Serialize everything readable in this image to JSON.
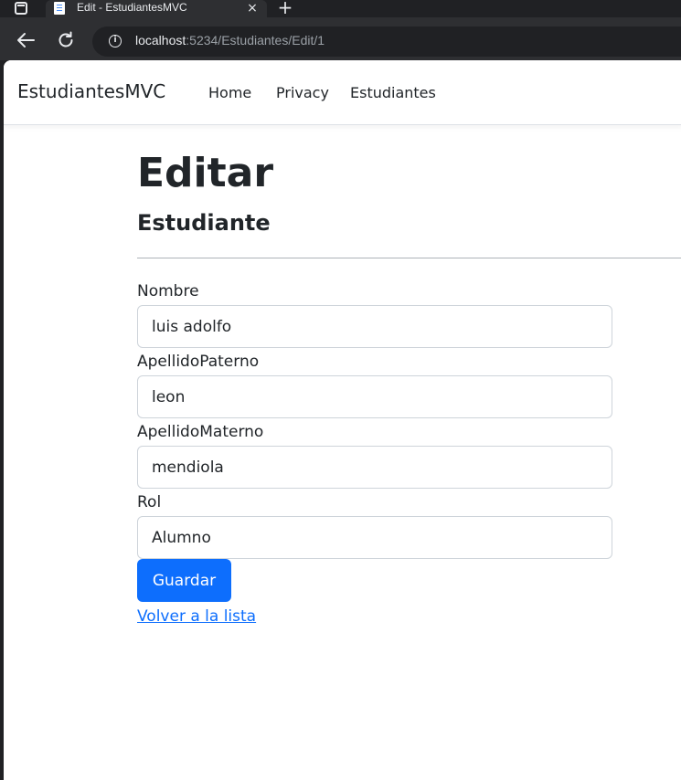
{
  "browser": {
    "tab": {
      "title": "Edit - EstudiantesMVC",
      "close_symbol": "×",
      "favicon": "page-icon"
    },
    "new_tab_symbol": "+",
    "address": {
      "host": "localhost",
      "path": ":5234/Estudiantes/Edit/1",
      "info_symbol": "i"
    },
    "icons": [
      "sidebar-toggle-icon",
      "back-arrow-icon",
      "reload-icon",
      "info-icon",
      "close-icon",
      "plus-icon"
    ]
  },
  "navbar": {
    "brand": "EstudiantesMVC",
    "links": [
      "Home",
      "Privacy",
      "Estudiantes"
    ]
  },
  "page": {
    "title": "Editar",
    "subtitle": "Estudiante"
  },
  "form": {
    "fields": [
      {
        "label": "Nombre",
        "value": "luis adolfo"
      },
      {
        "label": "ApellidoPaterno",
        "value": "leon"
      },
      {
        "label": "ApellidoMaterno",
        "value": "mendiola"
      },
      {
        "label": "Rol",
        "value": "Alumno"
      }
    ],
    "submit_label": "Guardar",
    "back_link": "Volver a la lista"
  },
  "colors": {
    "primary": "#0d6efd",
    "browser_dark": "#202124",
    "browser_toolbar": "#2e2f32",
    "text": "#212529",
    "input_border": "#ced4da"
  }
}
